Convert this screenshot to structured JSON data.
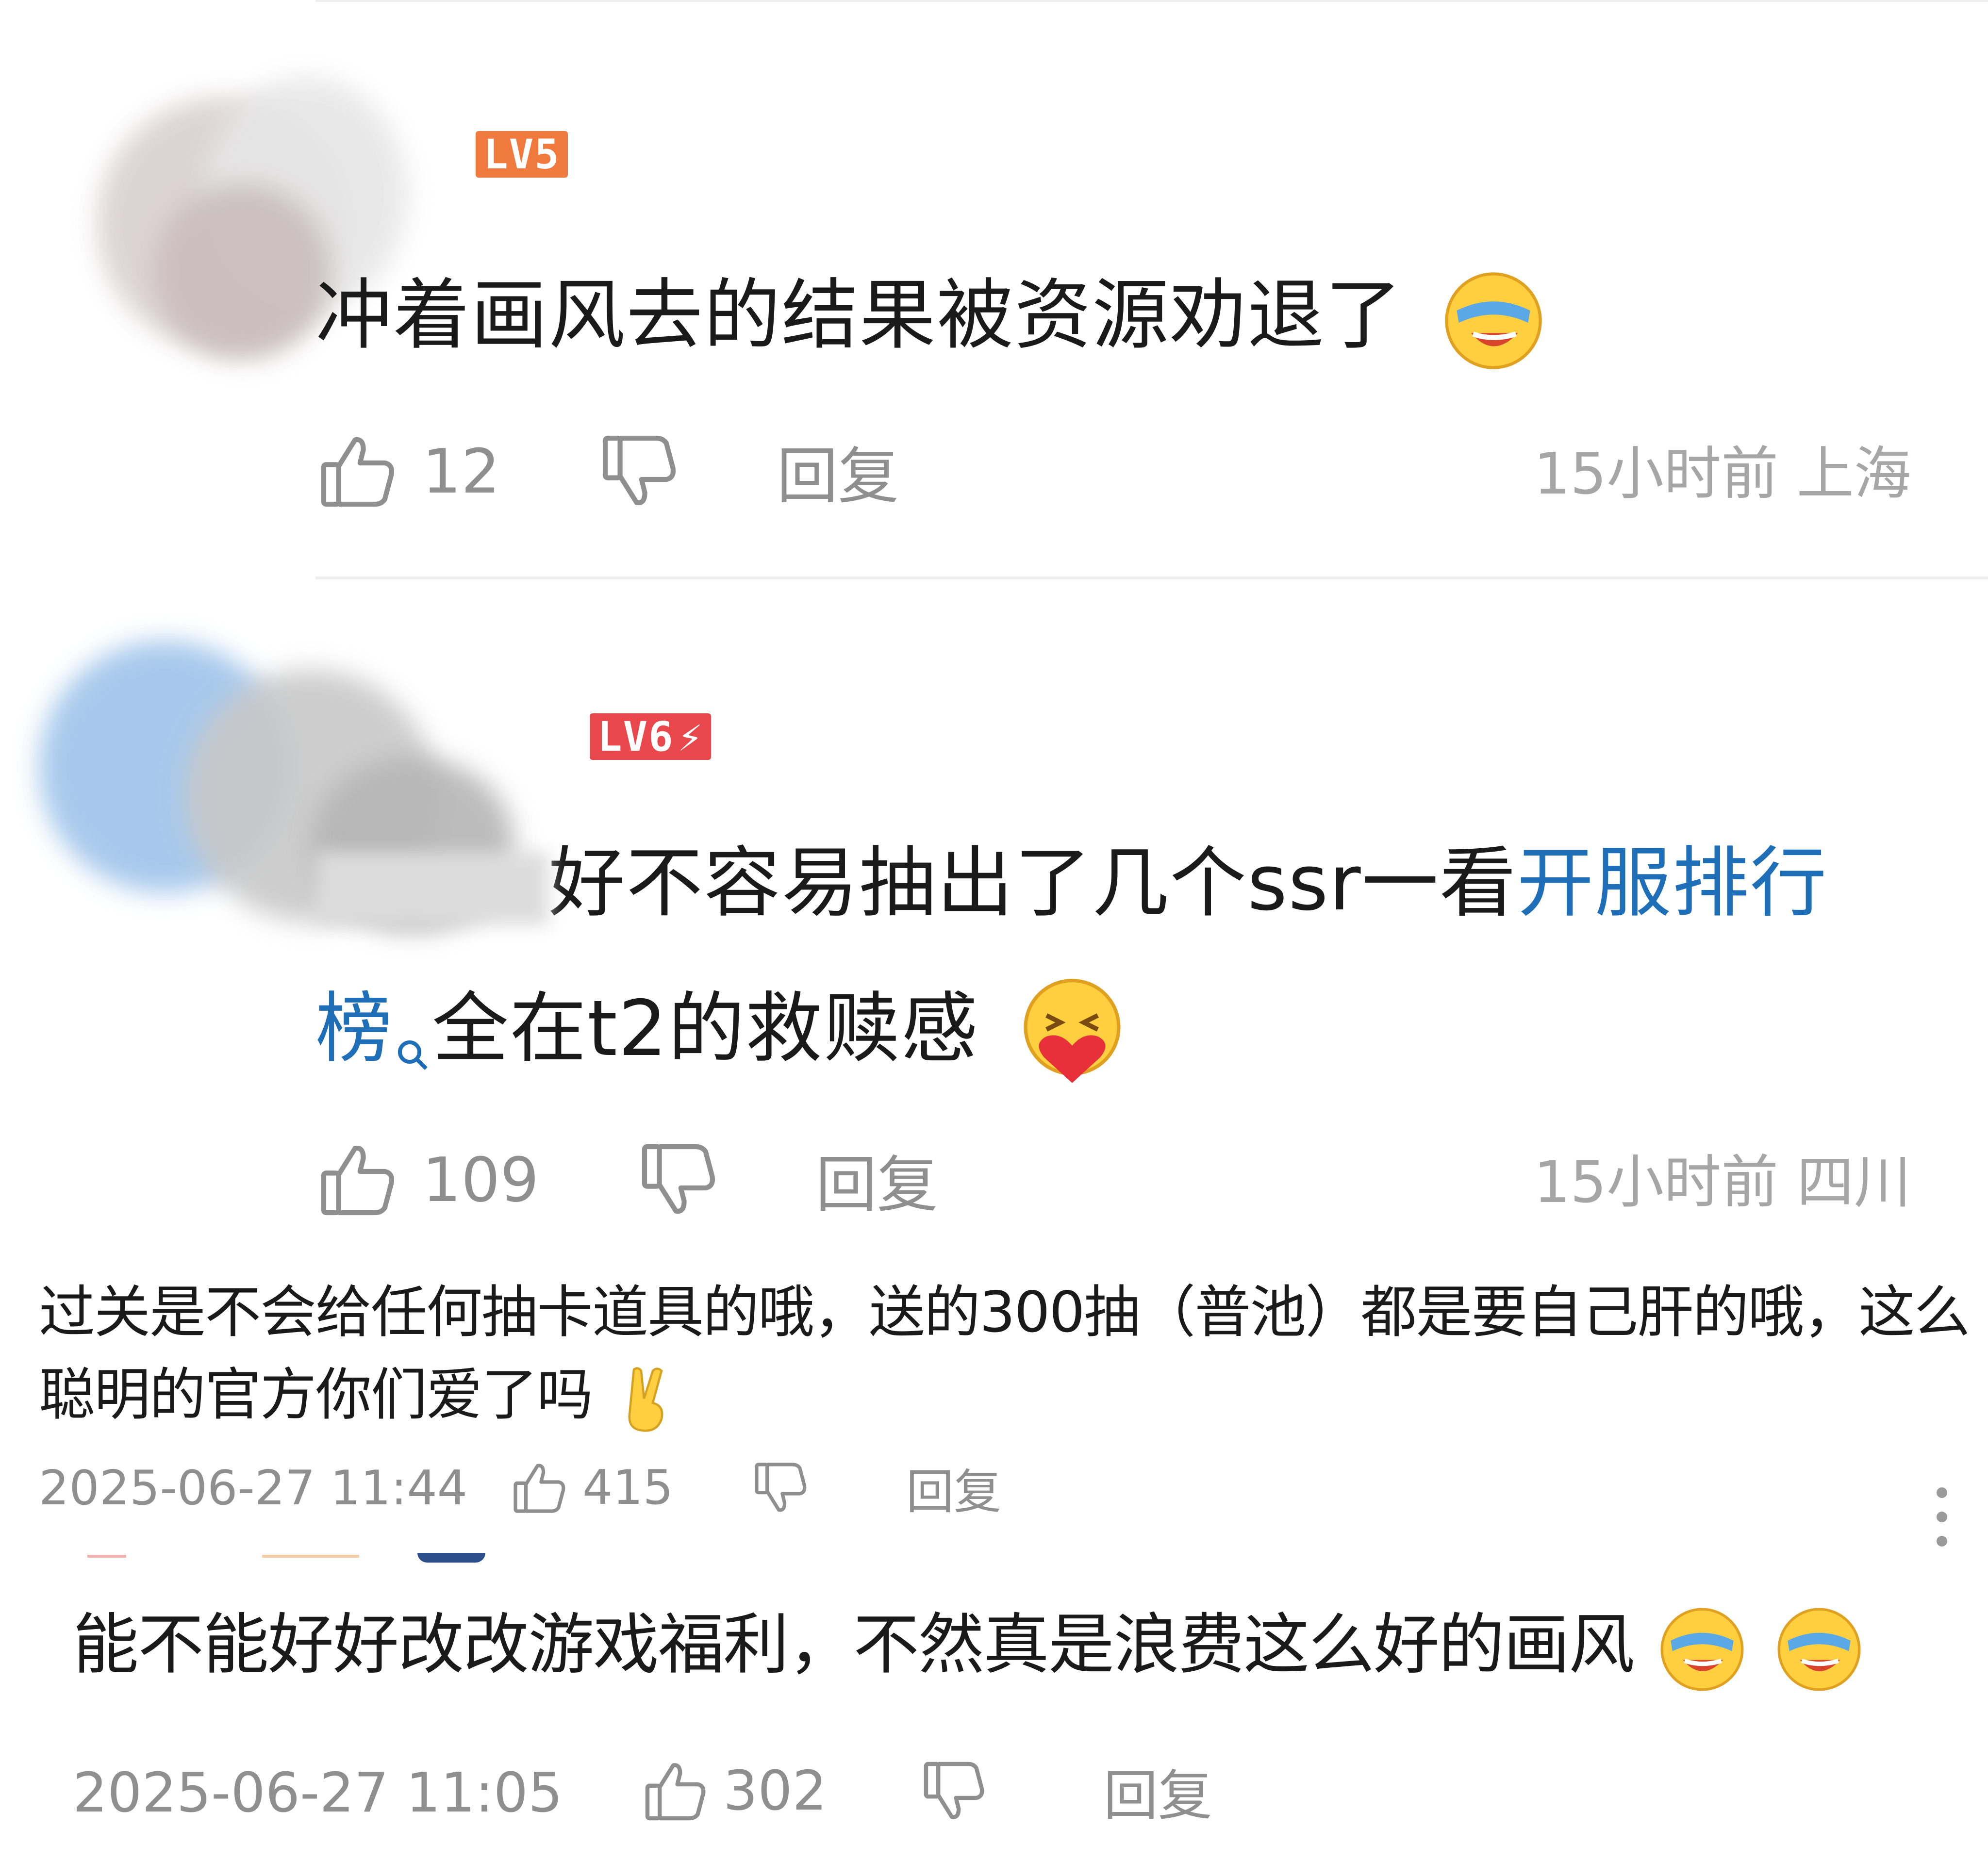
{
  "comments": [
    {
      "level": "LV5",
      "text": "冲着画风去的结果被资源劝退了",
      "likes": "12",
      "reply": "回复",
      "time_location": "15小时前 上海",
      "emoji": "laugh-cry-emoji",
      "badge_color": "#f07a3e"
    },
    {
      "level": "LV6",
      "text_before": "好不容易抽出了几个ssr一看",
      "link_line1": "开服排行",
      "link_line2": "榜",
      "text_after": "全在t2的救赎感",
      "likes": "109",
      "reply": "回复",
      "time_location": "15小时前 四川",
      "emoji": "heart-hug-emoji",
      "badge_color": "#e8484b",
      "link_color": "#1e6fb8"
    },
    {
      "line1": "过关是不会给任何抽卡道具的哦，送的300抽（普池）都是要自己肝的哦，这么",
      "line2": "聪明的官方你们爱了吗",
      "timestamp": "2025-06-27 11:44",
      "likes": "415",
      "reply": "回复",
      "emoji": "victory-hand-emoji"
    },
    {
      "text": "能不能好好改改游戏福利，不然真是浪费这么好的画风",
      "timestamp": "2025-06-27 11:05",
      "likes": "302",
      "reply": "回复",
      "emoji": "laugh-cry-emoji"
    }
  ]
}
